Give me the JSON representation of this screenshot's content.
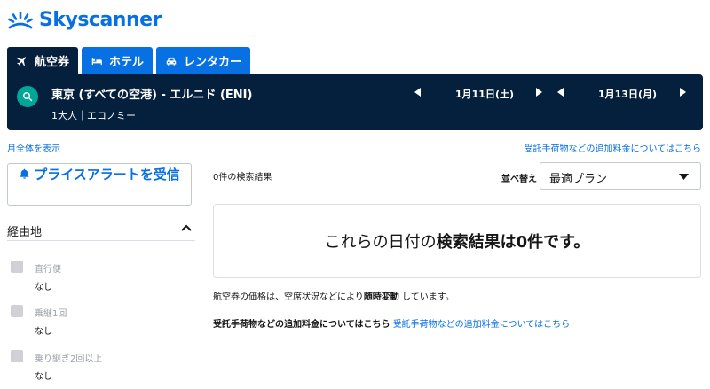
{
  "brand": {
    "name": "Skyscanner",
    "color": "#0770e3",
    "nav_color": "#05203c"
  },
  "tabs": [
    {
      "label": "航空券",
      "icon": "plane-icon",
      "active": true
    },
    {
      "label": "ホテル",
      "icon": "bed-icon",
      "active": false
    },
    {
      "label": "レンタカー",
      "icon": "car-icon",
      "active": false
    }
  ],
  "search": {
    "route": "東京 (すべての空港) - エルニド (ENI)",
    "passengers": "1大人｜エコノミー",
    "depart_date": "1月11日(土)",
    "return_date": "1月13日(月)"
  },
  "links": {
    "month_view": "月全体を表示",
    "baggage_fees": "受託手荷物などの追加料金についてはこちら"
  },
  "price_alert": {
    "label": "プライスアラートを受信"
  },
  "filters": {
    "stops": {
      "title": "経由地",
      "options": [
        {
          "label": "直行便",
          "sub": "なし"
        },
        {
          "label": "乗継1回",
          "sub": "なし"
        },
        {
          "label": "乗り継ぎ2回以上",
          "sub": "なし"
        }
      ]
    }
  },
  "results": {
    "count": "0件の検索結果",
    "sort_label": "並べ替え",
    "sort_value": "最適プラン",
    "no_results_pre": "これらの日付の",
    "no_results_bold": "検索結果は0件です。",
    "note_pre": "航空券の価格は、空席状況などにより",
    "note_bold": "随時変動",
    "note_post": "しています。",
    "fees_bold": "受託手荷物などの追加料金についてはこちら",
    "fees_link": "受託手荷物などの追加料金についてはこちら"
  }
}
